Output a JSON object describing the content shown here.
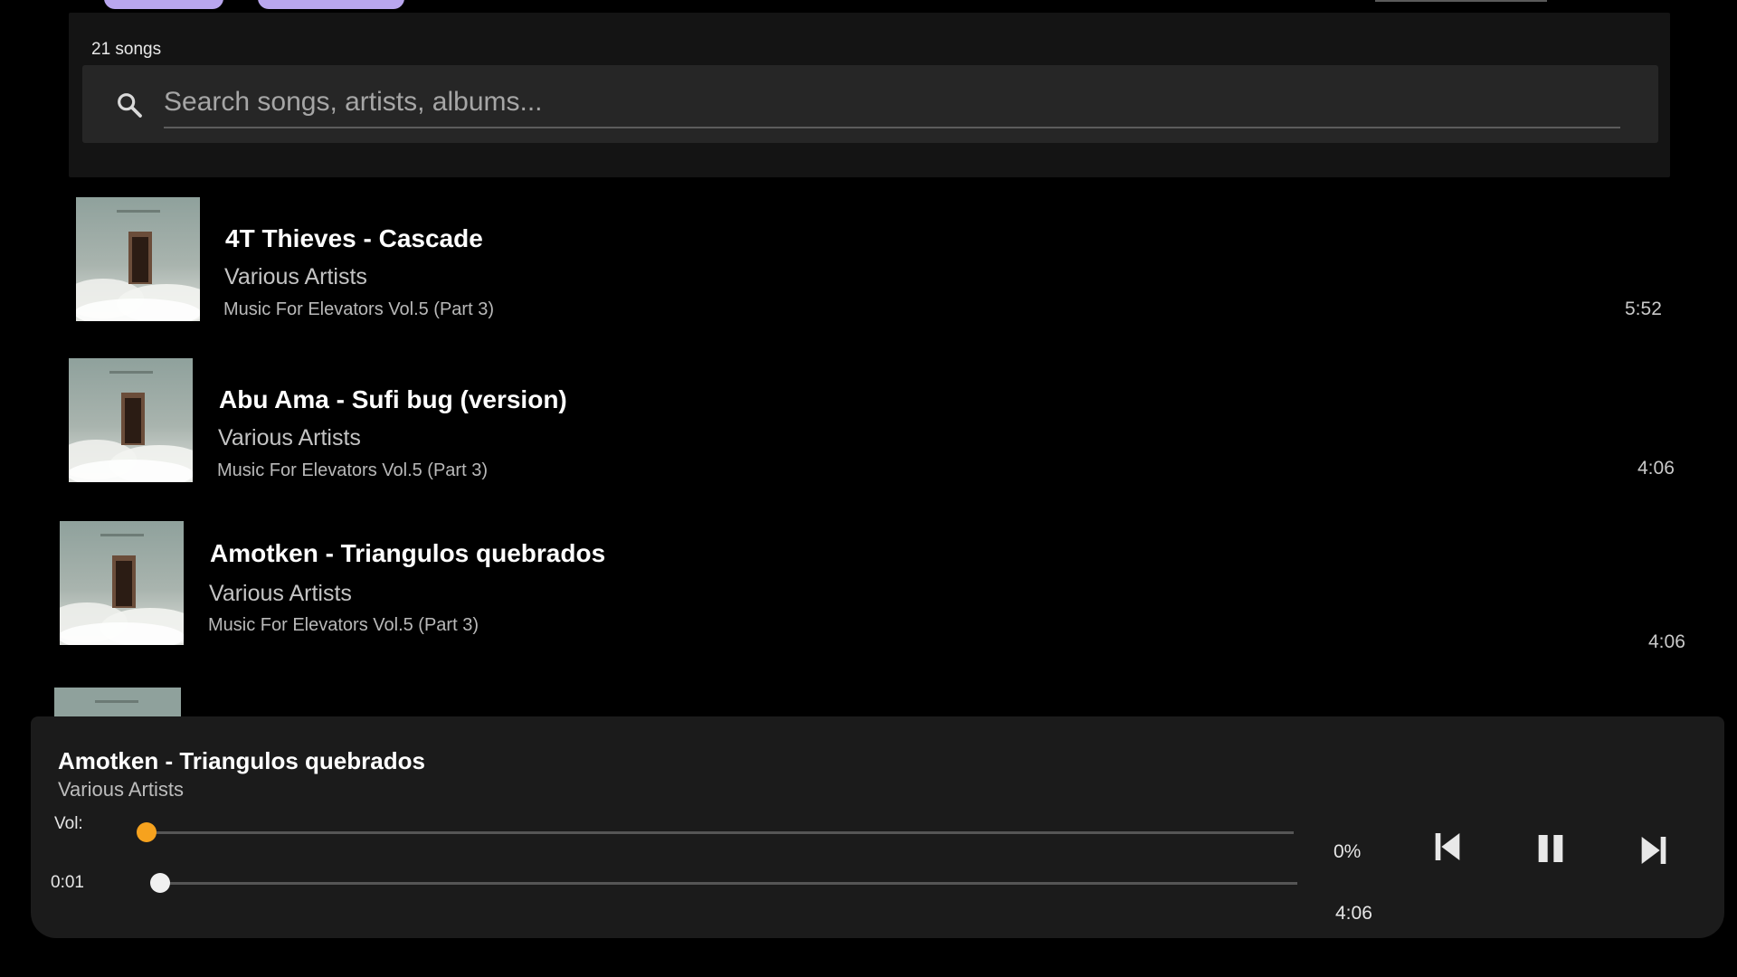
{
  "header": {
    "song_count": "21 songs",
    "search_placeholder": "Search songs, artists, albums..."
  },
  "songs": [
    {
      "title": "4T Thieves - Cascade",
      "artist": "Various Artists",
      "album": "Music For Elevators Vol.5 (Part 3)",
      "duration": "5:52"
    },
    {
      "title": "Abu Ama - Sufi bug (version)",
      "artist": "Various Artists",
      "album": "Music For Elevators Vol.5 (Part 3)",
      "duration": "4:06"
    },
    {
      "title": "Amotken - Triangulos quebrados",
      "artist": "Various Artists",
      "album": "Music For Elevators Vol.5 (Part 3)",
      "duration": "4:06"
    },
    {
      "title": "",
      "artist": "",
      "album": "",
      "duration": ""
    }
  ],
  "player": {
    "now_playing_title": "Amotken - Triangulos quebrados",
    "now_playing_artist": "Various Artists",
    "volume_label": "Vol:",
    "volume_percent": "0%",
    "volume_value": 0,
    "current_time": "0:01",
    "total_time": "4:06",
    "seek_fraction": 0.004
  },
  "icons": {
    "search": "search-icon",
    "previous": "skip-previous-icon",
    "pause": "pause-icon",
    "next": "skip-next-icon"
  },
  "colors": {
    "accent": "#f6a21e",
    "pill": "#b9a6ee"
  }
}
